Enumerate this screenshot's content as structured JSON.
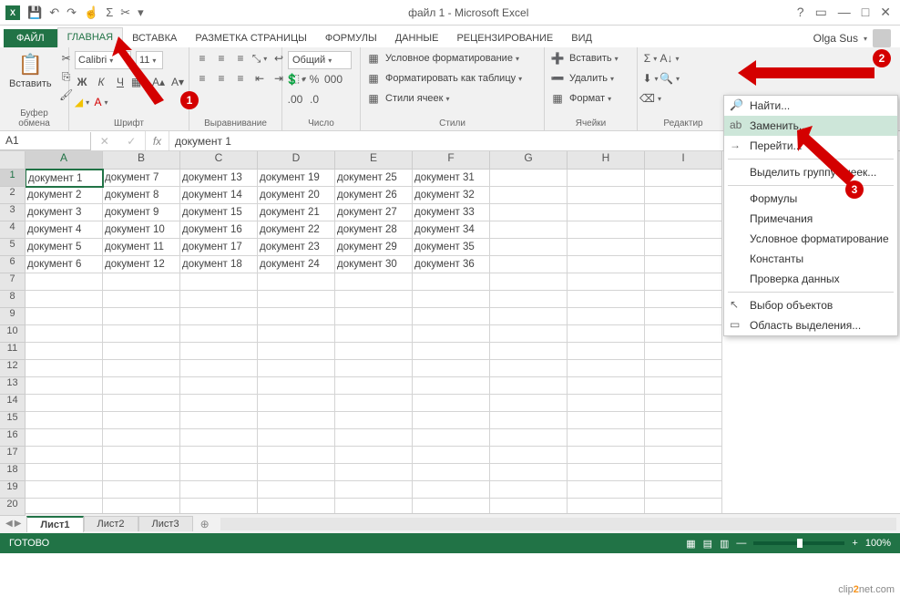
{
  "title": "файл 1 - Microsoft Excel",
  "account": "Olga Sus",
  "tabs": {
    "file": "ФАЙЛ",
    "home": "ГЛАВНАЯ",
    "insert": "ВСТАВКА",
    "layout": "РАЗМЕТКА СТРАНИЦЫ",
    "formulas": "ФОРМУЛЫ",
    "data": "ДАННЫЕ",
    "review": "РЕЦЕНЗИРОВАНИЕ",
    "view": "ВИД"
  },
  "ribbon": {
    "clipboard": {
      "label": "Буфер обмена",
      "paste": "Вставить"
    },
    "font": {
      "label": "Шрифт",
      "name": "Calibri",
      "size": "11"
    },
    "align": {
      "label": "Выравнивание"
    },
    "number": {
      "label": "Число",
      "format": "Общий"
    },
    "styles": {
      "label": "Стили",
      "cond": "Условное форматирование",
      "table": "Форматировать как таблицу",
      "cell": "Стили ячеек"
    },
    "cells": {
      "label": "Ячейки",
      "insert": "Вставить",
      "delete": "Удалить",
      "format": "Формат"
    },
    "edit": {
      "label": "Редактир"
    }
  },
  "namebox": "A1",
  "fx": "fx",
  "formula": "документ 1",
  "columns": [
    "A",
    "B",
    "C",
    "D",
    "E",
    "F",
    "G",
    "H",
    "I"
  ],
  "rows": [
    1,
    2,
    3,
    4,
    5,
    6,
    7,
    8,
    9,
    10,
    11,
    12,
    13,
    14,
    15,
    16,
    17,
    18,
    19,
    20
  ],
  "cells": [
    [
      "документ 1",
      "документ 7",
      "документ 13",
      "документ 19",
      "документ 25",
      "документ 31",
      "",
      "",
      ""
    ],
    [
      "документ 2",
      "документ 8",
      "документ 14",
      "документ 20",
      "документ 26",
      "документ 32",
      "",
      "",
      ""
    ],
    [
      "документ 3",
      "документ 9",
      "документ 15",
      "документ 21",
      "документ 27",
      "документ 33",
      "",
      "",
      ""
    ],
    [
      "документ 4",
      "документ 10",
      "документ 16",
      "документ 22",
      "документ 28",
      "документ 34",
      "",
      "",
      ""
    ],
    [
      "документ 5",
      "документ 11",
      "документ 17",
      "документ 23",
      "документ 29",
      "документ 35",
      "",
      "",
      ""
    ],
    [
      "документ 6",
      "документ 12",
      "документ 18",
      "документ 24",
      "документ 30",
      "документ 36",
      "",
      "",
      ""
    ]
  ],
  "sheets": {
    "s1": "Лист1",
    "s2": "Лист2",
    "s3": "Лист3"
  },
  "status": "ГОТОВО",
  "zoom": "100%",
  "menu": {
    "find": "Найти...",
    "replace": "Заменить...",
    "goto": "Перейти...",
    "selgroup": "Выделить группу ячеек...",
    "formulas": "Формулы",
    "comments": "Примечания",
    "condfmt": "Условное форматирование",
    "constants": "Константы",
    "datavalid": "Проверка данных",
    "selobj": "Выбор объектов",
    "selpane": "Область выделения..."
  },
  "callouts": {
    "c1": "1",
    "c2": "2",
    "c3": "3"
  },
  "watermark": {
    "a": "clip",
    "b": "2",
    "c": "net",
    "d": ".com"
  }
}
